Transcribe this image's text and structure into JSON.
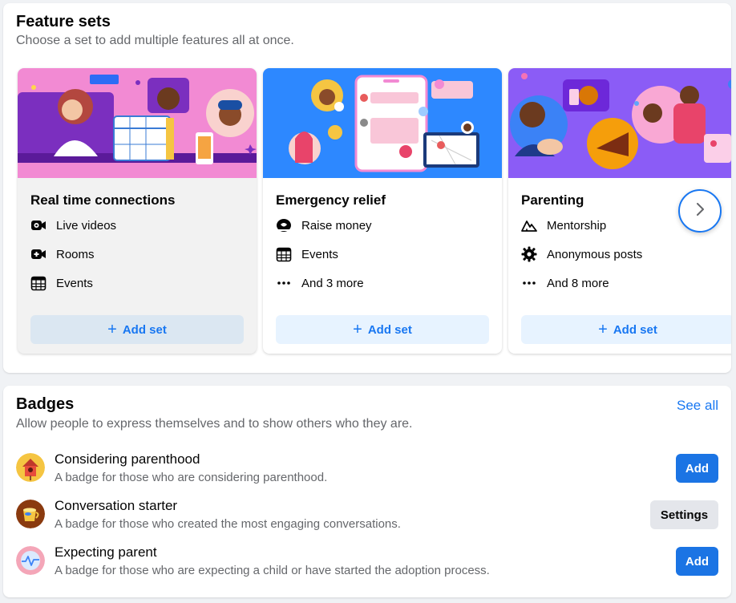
{
  "feature_sets": {
    "title": "Feature sets",
    "subtitle": "Choose a set to add multiple features all at once.",
    "cards": [
      {
        "title": "Real time connections",
        "features": [
          {
            "icon": "live-video-icon",
            "label": "Live videos"
          },
          {
            "icon": "video-camera-icon",
            "label": "Rooms"
          },
          {
            "icon": "calendar-icon",
            "label": "Events"
          }
        ],
        "button": "Add set"
      },
      {
        "title": "Emergency relief",
        "features": [
          {
            "icon": "piggy-bank-icon",
            "label": "Raise money"
          },
          {
            "icon": "calendar-icon",
            "label": "Events"
          },
          {
            "icon": "more-dots-icon",
            "label": "And 3 more"
          }
        ],
        "button": "Add set"
      },
      {
        "title": "Parenting",
        "features": [
          {
            "icon": "mountain-icon",
            "label": "Mentorship"
          },
          {
            "icon": "gear-icon",
            "label": "Anonymous posts"
          },
          {
            "icon": "more-dots-icon",
            "label": "And 8 more"
          }
        ],
        "button": "Add set"
      }
    ],
    "next_icon": "chevron-right-icon"
  },
  "badges": {
    "title": "Badges",
    "subtitle": "Allow people to express themselves and to show others who they are.",
    "see_all": "See all",
    "items": [
      {
        "name": "Considering parenthood",
        "description": "A badge for those who are considering parenthood.",
        "action": "Add",
        "icon": "birdhouse-icon"
      },
      {
        "name": "Conversation starter",
        "description": "A badge for those who created the most engaging conversations.",
        "action": "Settings",
        "icon": "coffee-cup-icon"
      },
      {
        "name": "Expecting parent",
        "description": "A badge for those who are expecting a child or have started the adoption process.",
        "action": "Add",
        "icon": "heartbeat-icon"
      }
    ]
  },
  "colors": {
    "accent": "#1877f2",
    "card1_art": "#f28ad3",
    "card2_art": "#2d88ff",
    "card3_art": "#8b5cf6"
  }
}
